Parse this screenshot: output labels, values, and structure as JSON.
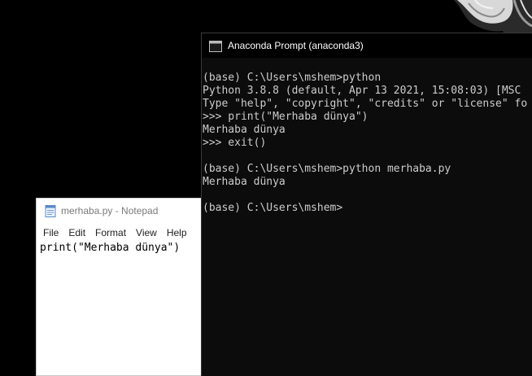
{
  "wallpaper": {
    "icon": "abstract-art"
  },
  "notepad": {
    "title": "merhaba.py - Notepad",
    "icon": "notepad-icon",
    "menu": [
      {
        "label": "File"
      },
      {
        "label": "Edit"
      },
      {
        "label": "Format"
      },
      {
        "label": "View"
      },
      {
        "label": "Help"
      }
    ],
    "content": "print(\"Merhaba dünya\")"
  },
  "console": {
    "title": "Anaconda Prompt (anaconda3)",
    "icon": "console-icon",
    "lines": [
      "(base) C:\\Users\\mshem>python",
      "Python 3.8.8 (default, Apr 13 2021, 15:08:03) [MSC",
      "Type \"help\", \"copyright\", \"credits\" or \"license\" fo",
      ">>> print(\"Merhaba dünya\")",
      "Merhaba dünya",
      ">>> exit()",
      "",
      "(base) C:\\Users\\mshem>python merhaba.py",
      "Merhaba dünya",
      "",
      "(base) C:\\Users\\mshem>"
    ]
  }
}
